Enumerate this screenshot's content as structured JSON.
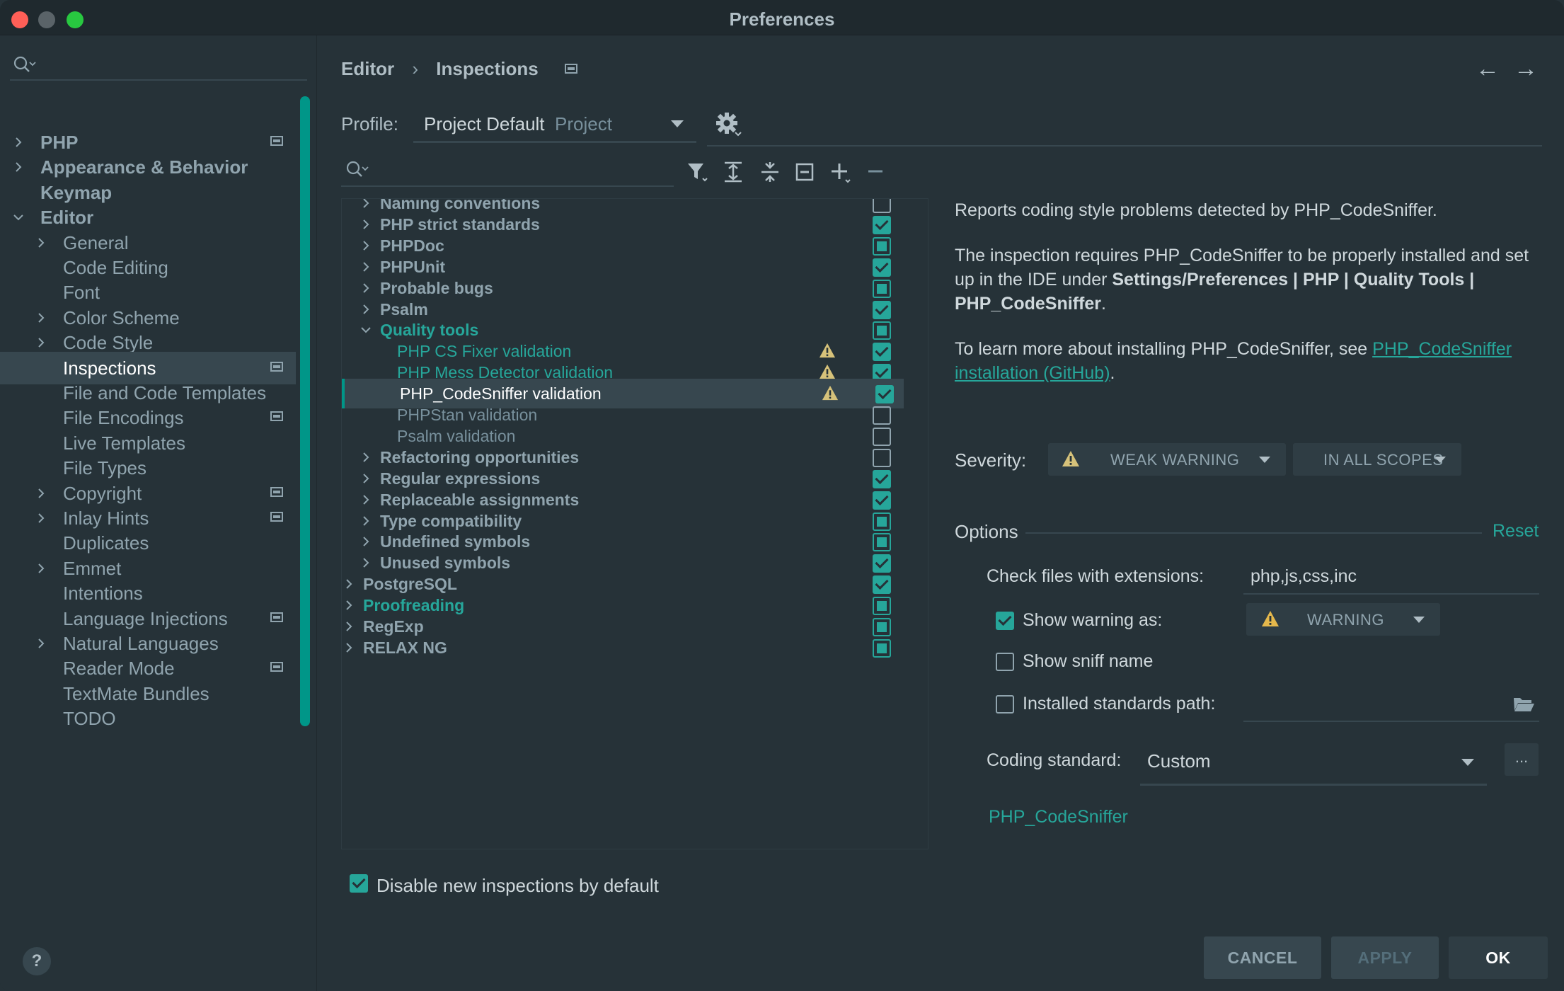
{
  "window": {
    "title": "Preferences"
  },
  "sidebar": {
    "search_placeholder": "",
    "items": [
      {
        "label": "PHP",
        "level": 0,
        "chevron": "right",
        "bold": true,
        "page_icon": true
      },
      {
        "label": "Appearance & Behavior",
        "level": 0,
        "chevron": "right",
        "bold": true,
        "page_icon": false
      },
      {
        "label": "Keymap",
        "level": 0,
        "chevron": "none",
        "bold": true,
        "page_icon": false
      },
      {
        "label": "Editor",
        "level": 0,
        "chevron": "down",
        "bold": true,
        "page_icon": false
      },
      {
        "label": "General",
        "level": 1,
        "chevron": "right",
        "bold": false,
        "page_icon": false
      },
      {
        "label": "Code Editing",
        "level": 1,
        "chevron": "none",
        "bold": false,
        "page_icon": false
      },
      {
        "label": "Font",
        "level": 1,
        "chevron": "none",
        "bold": false,
        "page_icon": false
      },
      {
        "label": "Color Scheme",
        "level": 1,
        "chevron": "right",
        "bold": false,
        "page_icon": false
      },
      {
        "label": "Code Style",
        "level": 1,
        "chevron": "right",
        "bold": false,
        "page_icon": false
      },
      {
        "label": "Inspections",
        "level": 1,
        "chevron": "none",
        "bold": false,
        "page_icon": true,
        "selected": true
      },
      {
        "label": "File and Code Templates",
        "level": 1,
        "chevron": "none",
        "bold": false,
        "page_icon": false
      },
      {
        "label": "File Encodings",
        "level": 1,
        "chevron": "none",
        "bold": false,
        "page_icon": true
      },
      {
        "label": "Live Templates",
        "level": 1,
        "chevron": "none",
        "bold": false,
        "page_icon": false
      },
      {
        "label": "File Types",
        "level": 1,
        "chevron": "none",
        "bold": false,
        "page_icon": false
      },
      {
        "label": "Copyright",
        "level": 1,
        "chevron": "right",
        "bold": false,
        "page_icon": true
      },
      {
        "label": "Inlay Hints",
        "level": 1,
        "chevron": "right",
        "bold": false,
        "page_icon": true
      },
      {
        "label": "Duplicates",
        "level": 1,
        "chevron": "none",
        "bold": false,
        "page_icon": false
      },
      {
        "label": "Emmet",
        "level": 1,
        "chevron": "right",
        "bold": false,
        "page_icon": false
      },
      {
        "label": "Intentions",
        "level": 1,
        "chevron": "none",
        "bold": false,
        "page_icon": false
      },
      {
        "label": "Language Injections",
        "level": 1,
        "chevron": "none",
        "bold": false,
        "page_icon": true
      },
      {
        "label": "Natural Languages",
        "level": 1,
        "chevron": "right",
        "bold": false,
        "page_icon": false
      },
      {
        "label": "Reader Mode",
        "level": 1,
        "chevron": "none",
        "bold": false,
        "page_icon": true
      },
      {
        "label": "TextMate Bundles",
        "level": 1,
        "chevron": "none",
        "bold": false,
        "page_icon": false
      },
      {
        "label": "TODO",
        "level": 1,
        "chevron": "none",
        "bold": false,
        "page_icon": false
      }
    ],
    "help_label": "?"
  },
  "breadcrumb": {
    "parent": "Editor",
    "separator": "›",
    "current": "Inspections"
  },
  "nav": {
    "back": "←",
    "forward": "→"
  },
  "profile": {
    "label": "Profile:",
    "name": "Project Default",
    "scope": "Project"
  },
  "tree": {
    "search_placeholder": "",
    "rows": [
      {
        "label": "Naming conventions",
        "type": "cat",
        "chevron": "right",
        "state": "off",
        "warn": false,
        "teal": false
      },
      {
        "label": "PHP strict standards",
        "type": "cat",
        "chevron": "right",
        "state": "on",
        "warn": false,
        "teal": false
      },
      {
        "label": "PHPDoc",
        "type": "cat",
        "chevron": "right",
        "state": "partial",
        "warn": false,
        "teal": false
      },
      {
        "label": "PHPUnit",
        "type": "cat",
        "chevron": "right",
        "state": "on",
        "warn": false,
        "teal": false
      },
      {
        "label": "Probable bugs",
        "type": "cat",
        "chevron": "right",
        "state": "partial",
        "warn": false,
        "teal": false
      },
      {
        "label": "Psalm",
        "type": "cat",
        "chevron": "right",
        "state": "on",
        "warn": false,
        "teal": false
      },
      {
        "label": "Quality tools",
        "type": "cat",
        "chevron": "down",
        "state": "partial",
        "warn": false,
        "teal": true
      },
      {
        "label": "PHP CS Fixer validation",
        "type": "leaf",
        "chevron": "none",
        "state": "on",
        "warn": true,
        "teal": true
      },
      {
        "label": "PHP Mess Detector validation",
        "type": "leaf",
        "chevron": "none",
        "state": "on",
        "warn": true,
        "teal": true
      },
      {
        "label": "PHP_CodeSniffer validation",
        "type": "leaf",
        "chevron": "none",
        "state": "on",
        "warn": true,
        "teal": false,
        "selected": true
      },
      {
        "label": "PHPStan validation",
        "type": "leaf",
        "chevron": "none",
        "state": "off",
        "warn": false,
        "teal": false
      },
      {
        "label": "Psalm validation",
        "type": "leaf",
        "chevron": "none",
        "state": "off",
        "warn": false,
        "teal": false
      },
      {
        "label": "Refactoring opportunities",
        "type": "cat",
        "chevron": "right",
        "state": "off",
        "warn": false,
        "teal": false
      },
      {
        "label": "Regular expressions",
        "type": "cat",
        "chevron": "right",
        "state": "on",
        "warn": false,
        "teal": false
      },
      {
        "label": "Replaceable assignments",
        "type": "cat",
        "chevron": "right",
        "state": "on",
        "warn": false,
        "teal": false
      },
      {
        "label": "Type compatibility",
        "type": "cat",
        "chevron": "right",
        "state": "partial",
        "warn": false,
        "teal": false
      },
      {
        "label": "Undefined symbols",
        "type": "cat",
        "chevron": "right",
        "state": "partial",
        "warn": false,
        "teal": false
      },
      {
        "label": "Unused symbols",
        "type": "cat",
        "chevron": "right",
        "state": "on",
        "warn": false,
        "teal": false
      },
      {
        "label": "PostgreSQL",
        "type": "top",
        "chevron": "right",
        "state": "on",
        "warn": false,
        "teal": false
      },
      {
        "label": "Proofreading",
        "type": "top",
        "chevron": "right",
        "state": "partial",
        "warn": false,
        "teal": true
      },
      {
        "label": "RegExp",
        "type": "top",
        "chevron": "right",
        "state": "partial",
        "warn": false,
        "teal": false
      },
      {
        "label": "RELAX NG",
        "type": "top",
        "chevron": "right",
        "state": "partial",
        "warn": false,
        "teal": false
      }
    ]
  },
  "bottom_option": {
    "label": "Disable new inspections by default",
    "checked": true
  },
  "description": {
    "p1": "Reports coding style problems detected by PHP_CodeSniffer.",
    "p2_prefix": "The inspection requires PHP_CodeSniffer to be properly installed and set up in the IDE under ",
    "p2_bold": "Settings/Preferences | PHP | Quality Tools | PHP_CodeSniffer",
    "p2_suffix": ".",
    "p3_prefix": "To learn more about installing PHP_CodeSniffer, see ",
    "p3_link": "PHP_CodeSniffer installation (GitHub)",
    "p3_suffix": "."
  },
  "severity": {
    "label": "Severity:",
    "value": "WEAK WARNING",
    "scope": "IN ALL SCOPES"
  },
  "options": {
    "title": "Options",
    "reset": "Reset",
    "extensions_label": "Check files with extensions:",
    "extensions_value": "php,js,css,inc",
    "show_warning_label": "Show warning as:",
    "show_warning_checked": true,
    "show_warning_value": "WARNING",
    "show_sniff_label": "Show sniff name",
    "show_sniff_checked": false,
    "standards_path_label": "Installed standards path:",
    "standards_path_checked": false,
    "standards_path_value": "",
    "coding_standard_label": "Coding standard:",
    "coding_standard_value": "Custom",
    "dots_label": "...",
    "sniffer_link": "PHP_CodeSniffer"
  },
  "buttons": {
    "cancel": "CANCEL",
    "apply": "APPLY",
    "ok": "OK"
  },
  "colors": {
    "background": "#263238",
    "accent": "#26a69a",
    "selection": "#37474f",
    "warning": "#e0c56e"
  }
}
